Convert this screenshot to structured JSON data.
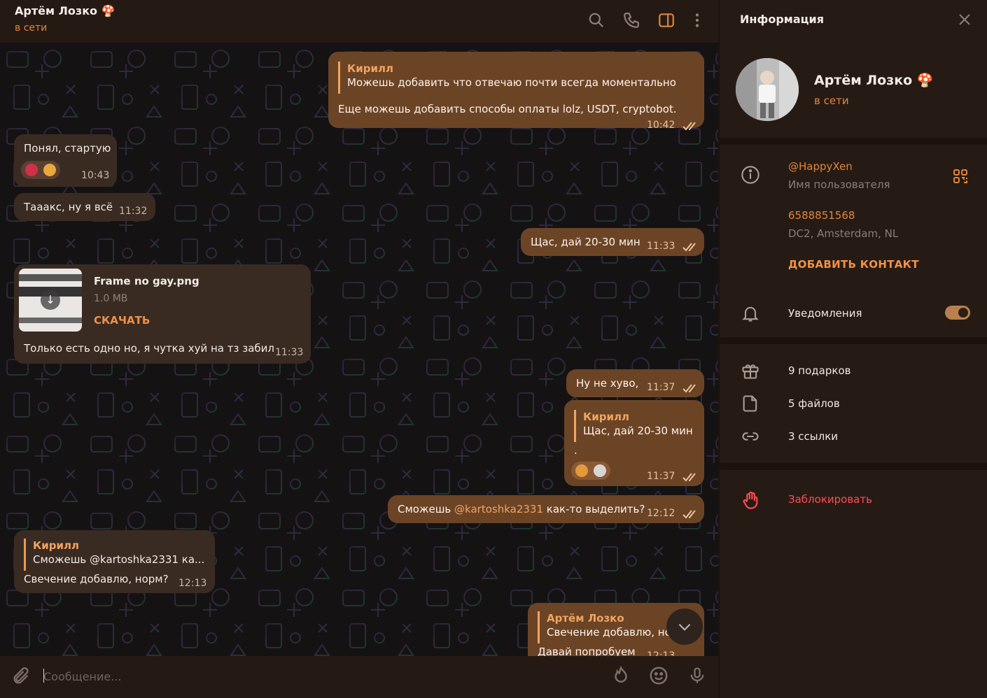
{
  "header": {
    "name": "Артём Лозко",
    "status": "в сети"
  },
  "messages": {
    "m1": {
      "reply_name": "Кирилл",
      "reply_text": "Можешь добавить что отвечаю почти всегда моментально",
      "text": "Еще можешь добавить способы оплаты lolz, USDT, cryptobot.",
      "time": "10:42"
    },
    "m2": {
      "text": "Понял, стартую",
      "time": "10:43"
    },
    "m3": {
      "text": "Тааакс, ну я всё",
      "time": "11:32"
    },
    "m4": {
      "text": "Щас, дай 20-30 мин",
      "time": "11:33"
    },
    "m5": {
      "file_name": "Frame no gay.png",
      "file_size": "1.0 MB",
      "download": "СКАЧАТЬ",
      "text": "Только есть одно но, я чутка хуй на тз забил",
      "time": "11:33"
    },
    "m6": {
      "text": "Ну не хуво,",
      "time": "11:37"
    },
    "m7": {
      "reply_name": "Кирилл",
      "reply_text": "Щас, дай 20-30 мин",
      "text": ".",
      "time": "11:37"
    },
    "m8": {
      "text_before": "Сможешь ",
      "mention": "@kartoshka2331",
      "text_after": " как-то выделить?",
      "time": "12:12"
    },
    "m9": {
      "reply_name": "Кирилл",
      "reply_text": "Сможешь @kartoshka2331 ка...",
      "text": "Свечение добавлю, норм?",
      "time": "12:13"
    },
    "m10": {
      "reply_name": "Артём Лозко",
      "reply_text": "Свечение добавлю, но",
      "text": "Давай попробуем",
      "time": "12:13"
    }
  },
  "input": {
    "placeholder": "Сообщение..."
  },
  "panel": {
    "title": "Информация",
    "name": "Артём Лозко",
    "status": "в сети",
    "username": "@HappyXen",
    "username_label": "Имя пользователя",
    "id": "6588851568",
    "dc": "DC2, Amsterdam, NL",
    "add_contact": "ДОБАВИТЬ КОНТАКТ",
    "notifications": "Уведомления",
    "notifications_on": true,
    "gifts": "9 подарков",
    "files": "5 файлов",
    "links": "3 ссылки",
    "block": "Заблокировать"
  },
  "colors": {
    "accent": "#e2853e",
    "outgoing_bubble": "#6b4426",
    "incoming_bubble": "#3a2b22",
    "danger": "#ff4d55"
  }
}
